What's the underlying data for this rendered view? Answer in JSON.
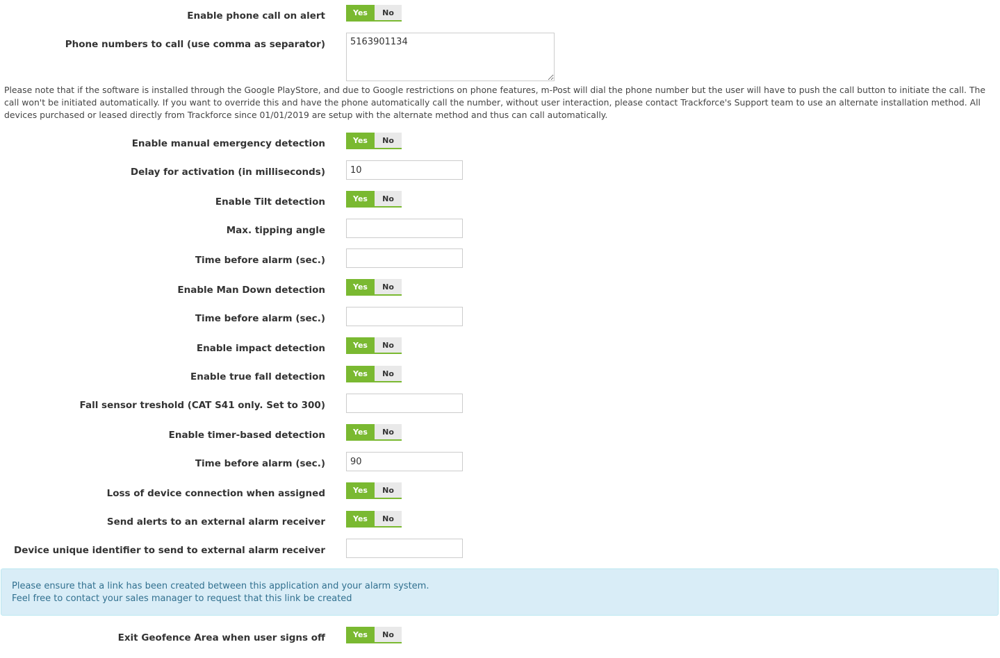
{
  "toggle": {
    "yes": "Yes",
    "no": "No"
  },
  "phone_call": {
    "label": "Enable phone call on alert",
    "enabled": true
  },
  "phone_numbers": {
    "label": "Phone numbers to call (use comma as separator)",
    "value": "5163901134"
  },
  "playstore_note": "Please note that if the software is installed through the Google PlayStore, and due to Google restrictions on phone features, m-Post will dial the phone number but the user will have to push the call button to initiate the call. The call won't be initiated automatically. If you want to override this and have the phone automatically call the number, without user interaction, please contact Trackforce's Support team to use an alternate installation method. All devices purchased or leased directly from Trackforce since 01/01/2019 are setup with the alternate method and thus can call automatically.",
  "manual_emergency": {
    "label": "Enable manual emergency detection",
    "enabled": true
  },
  "activation_delay": {
    "label": "Delay for activation (in milliseconds)",
    "value": "10"
  },
  "tilt": {
    "label": "Enable Tilt detection",
    "enabled": true
  },
  "tipping_angle": {
    "label": "Max. tipping angle",
    "value": ""
  },
  "tilt_time": {
    "label": "Time before alarm (sec.)",
    "value": ""
  },
  "man_down": {
    "label": "Enable Man Down detection",
    "enabled": true
  },
  "man_down_time": {
    "label": "Time before alarm (sec.)",
    "value": ""
  },
  "impact": {
    "label": "Enable impact detection",
    "enabled": true
  },
  "true_fall": {
    "label": "Enable true fall detection",
    "enabled": true
  },
  "fall_threshold": {
    "label": "Fall sensor treshold (CAT S41 only. Set to 300)",
    "value": ""
  },
  "timer_based": {
    "label": "Enable timer-based detection",
    "enabled": true
  },
  "timer_time": {
    "label": "Time before alarm (sec.)",
    "value": "90"
  },
  "loss_connection": {
    "label": "Loss of device connection when assigned",
    "enabled": true
  },
  "external_receiver": {
    "label": "Send alerts to an external alarm receiver",
    "enabled": true
  },
  "device_identifier": {
    "label": "Device unique identifier to send to external alarm receiver",
    "value": ""
  },
  "info_box": {
    "line1": "Please ensure that a link has been created between this application and your alarm system.",
    "line2": "Feel free to contact your sales manager to request that this link be created"
  },
  "exit_geofence": {
    "label": "Exit Geofence Area when user signs off",
    "enabled": true
  },
  "colors": {
    "toggle_on": "#7ab931",
    "toggle_off": "#e9e9e9",
    "info_bg": "#d9edf7",
    "info_text": "#31708f"
  }
}
